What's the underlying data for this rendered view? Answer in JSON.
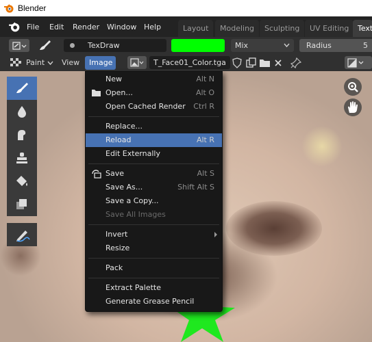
{
  "window": {
    "title": "Blender"
  },
  "menubar": {
    "items": [
      "File",
      "Edit",
      "Render",
      "Window",
      "Help"
    ],
    "workspaces": [
      "Layout",
      "Modeling",
      "Sculpting",
      "UV Editing",
      "Text"
    ],
    "active_workspace": "Layout"
  },
  "tool_header": {
    "brush_name": "TexDraw",
    "color": "#00ff00",
    "blend_mode": "Mix",
    "radius_label": "Radius",
    "radius_value": "5"
  },
  "mode_header": {
    "mode": "Paint",
    "view_label": "View",
    "image_label": "Image",
    "image_name": "T_Face01_Color.tga"
  },
  "image_menu": {
    "items": [
      {
        "label": "New",
        "shortcut": "Alt N",
        "icon": "",
        "state": "normal"
      },
      {
        "label": "Open...",
        "shortcut": "Alt O",
        "icon": "folder-icon",
        "state": "normal"
      },
      {
        "label": "Open Cached Render",
        "shortcut": "Ctrl R",
        "icon": "",
        "state": "normal"
      },
      {
        "label": "Replace...",
        "shortcut": "",
        "icon": "",
        "state": "normal"
      },
      {
        "label": "Reload",
        "shortcut": "Alt R",
        "icon": "",
        "state": "highlighted"
      },
      {
        "label": "Edit Externally",
        "shortcut": "",
        "icon": "",
        "state": "normal"
      },
      {
        "label": "Save",
        "shortcut": "Alt S",
        "icon": "save-icon",
        "state": "normal"
      },
      {
        "label": "Save As...",
        "shortcut": "Shift Alt S",
        "icon": "",
        "state": "normal"
      },
      {
        "label": "Save a Copy...",
        "shortcut": "",
        "icon": "",
        "state": "normal"
      },
      {
        "label": "Save All Images",
        "shortcut": "",
        "icon": "",
        "state": "disabled"
      },
      {
        "label": "Invert",
        "shortcut": "",
        "icon": "",
        "state": "submenu"
      },
      {
        "label": "Resize",
        "shortcut": "",
        "icon": "",
        "state": "normal"
      },
      {
        "label": "Pack",
        "shortcut": "",
        "icon": "",
        "state": "normal"
      },
      {
        "label": "Extract Palette",
        "shortcut": "",
        "icon": "",
        "state": "normal"
      },
      {
        "label": "Generate Grease Pencil",
        "shortcut": "",
        "icon": "",
        "state": "normal"
      }
    ]
  },
  "colors": {
    "accent": "#4772b3",
    "paint": "#00ff00"
  }
}
